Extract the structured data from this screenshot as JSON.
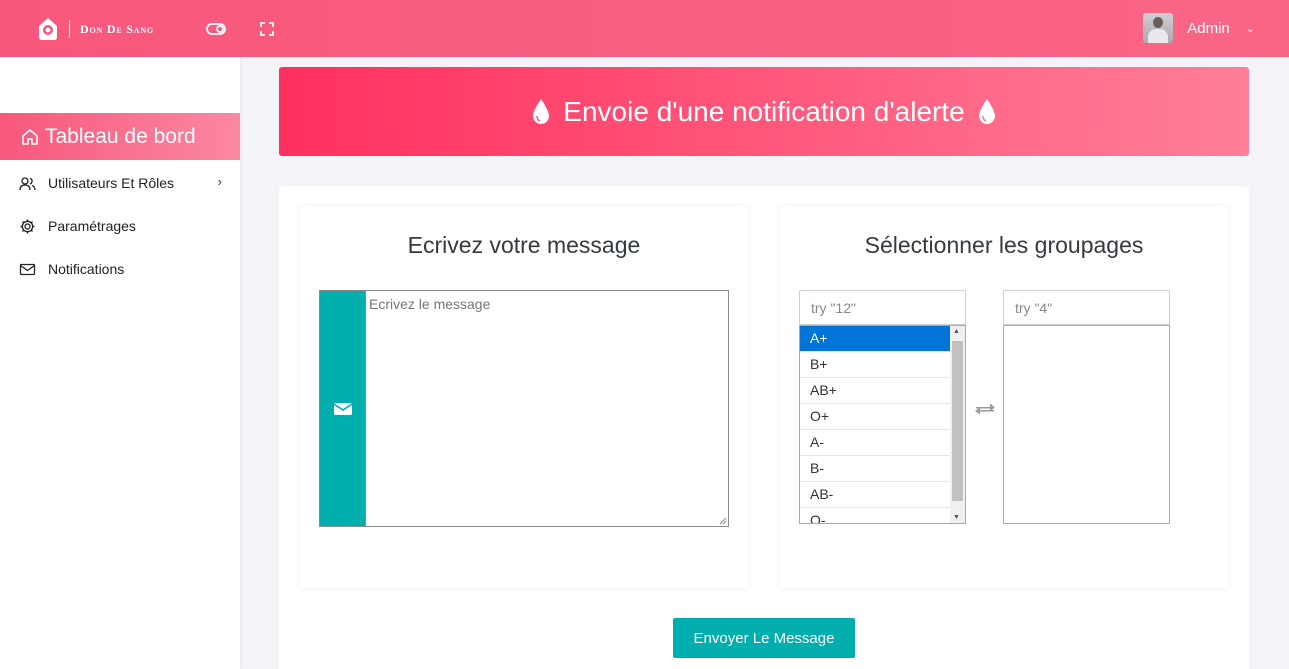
{
  "header": {
    "brand": "Don De Sang",
    "user_name": "Admin",
    "caret": "⌄"
  },
  "sidebar": {
    "active": {
      "label": "Tableau de bord",
      "icon": "home-icon"
    },
    "items": [
      {
        "label": "Utilisateurs Et Rôles",
        "icon": "users-icon",
        "chevron": "›"
      },
      {
        "label": "Paramétrages",
        "icon": "gear-icon"
      },
      {
        "label": "Notifications",
        "icon": "mail-icon"
      }
    ]
  },
  "banner": {
    "title": "Envoie d'une notification d'alerte"
  },
  "message_panel": {
    "title": "Ecrivez votre message",
    "placeholder": "Ecrivez le message"
  },
  "groups_panel": {
    "title": "Sélectionner les groupages",
    "filter_left_placeholder": "try \"12\"",
    "filter_right_placeholder": "try \"4\"",
    "options": [
      "A+",
      "B+",
      "AB+",
      "O+",
      "A-",
      "B-",
      "AB-",
      "O-"
    ],
    "selected": "A+",
    "selected_list": []
  },
  "actions": {
    "send_label": "Envoyer Le Message"
  },
  "colors": {
    "primary": "#f7577c",
    "teal": "#00aeae",
    "select": "#0074d7"
  }
}
